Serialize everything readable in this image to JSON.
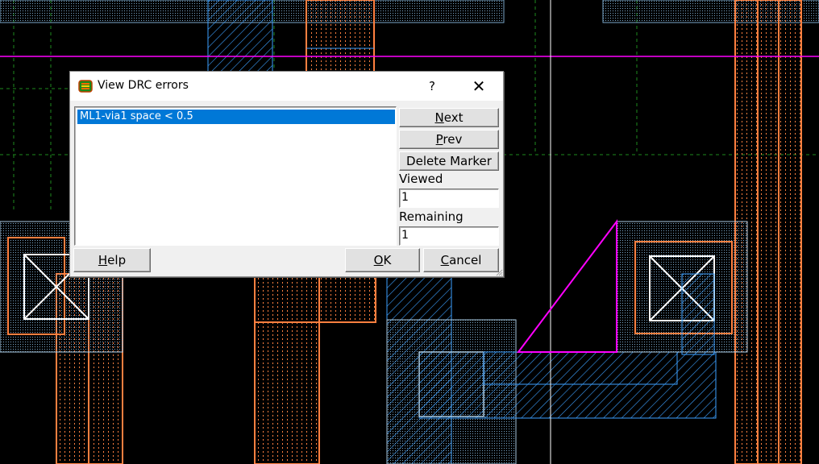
{
  "dialog": {
    "title": "View DRC errors",
    "help_glyph": "?",
    "close_glyph": "✕",
    "errors": [
      "ML1-via1 space < 0.5"
    ],
    "selected_index": 0,
    "buttons": {
      "next": {
        "mnemonic": "N",
        "rest": "ext"
      },
      "prev": {
        "mnemonic": "P",
        "rest": "rev"
      },
      "delete_marker": "Delete Marker",
      "help": {
        "mnemonic": "H",
        "rest": "elp"
      },
      "ok": {
        "mnemonic": "O",
        "rest": "K"
      },
      "cancel": {
        "mnemonic": "C",
        "rest": "ancel"
      }
    },
    "viewed_label": "Viewed",
    "viewed_value": "1",
    "remaining_label": "Remaining",
    "remaining_value": "1"
  },
  "layout_view": {
    "background": "#000000",
    "colors": {
      "metal_orange": "#ff8040",
      "via_blue": "#3ca0ff",
      "cut_white": "#ffffff",
      "marker_magenta": "#ff00ff",
      "grid_green": "#1e8a1e",
      "guide_blue": "#4040ff"
    }
  },
  "icons": {
    "app": "drc-app-icon",
    "help": "help-icon",
    "close": "close-icon",
    "resize": "resize-grip-icon"
  }
}
